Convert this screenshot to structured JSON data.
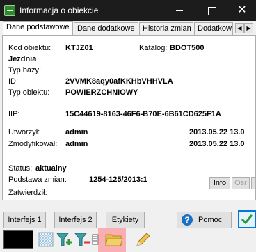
{
  "window": {
    "title": "Informacja o obiekcie",
    "close_glyph": "✕"
  },
  "tabs": [
    "Dane podstawowe",
    "Dane dodatkowe",
    "Historia zmian",
    "Dodatkowe"
  ],
  "tab_arrows": {
    "left": "◀",
    "right": "▶"
  },
  "fields": {
    "kod_label": "Kod obiektu:",
    "kod_value": "KTJZ01",
    "katalog_label": "Katalog:",
    "katalog_value": "BDOT500",
    "name": "Jezdnia",
    "typ_bazy_label": "Typ bazy:",
    "id_label": "ID:",
    "id_value": "2VVMK8aqy0afKKHbVHHVLA",
    "typ_obiektu_label": "Typ obiektu:",
    "typ_obiektu_value": "POWIERZCHNIOWY",
    "iip_label": "IIP:",
    "iip_value": "15C44619-8163-46F6-B70E-6B61CD625F1A",
    "utworzyl_label": "Utworzył:",
    "utworzyl_value": "admin",
    "utworzyl_date": "2013.05.22 13.0",
    "zmodyfikowal_label": "Zmodyfikował:",
    "zmodyfikowal_value": "admin",
    "zmodyfikowal_date": "2013.05.22 13.0",
    "status_label": "Status:",
    "status_value": "aktualny",
    "podstawa_label": "Podstawa zmian:",
    "podstawa_value": "1254-125/2013:1",
    "zatwierdzil_label": "Zatwierdził:"
  },
  "panel_buttons": {
    "info": "Info",
    "osr": "Osr"
  },
  "buttons": {
    "interfejs1": "Interfejs 1",
    "interfejs2": "Interfejs 2",
    "etykiety": "Etykiety",
    "pomoc": "Pomoc",
    "help_glyph": "?"
  },
  "colors": {
    "ok_check": "#2a9a3a",
    "help_circle": "#1d6fc4",
    "highlight": "#ff7882",
    "folder": "#e8b948"
  }
}
